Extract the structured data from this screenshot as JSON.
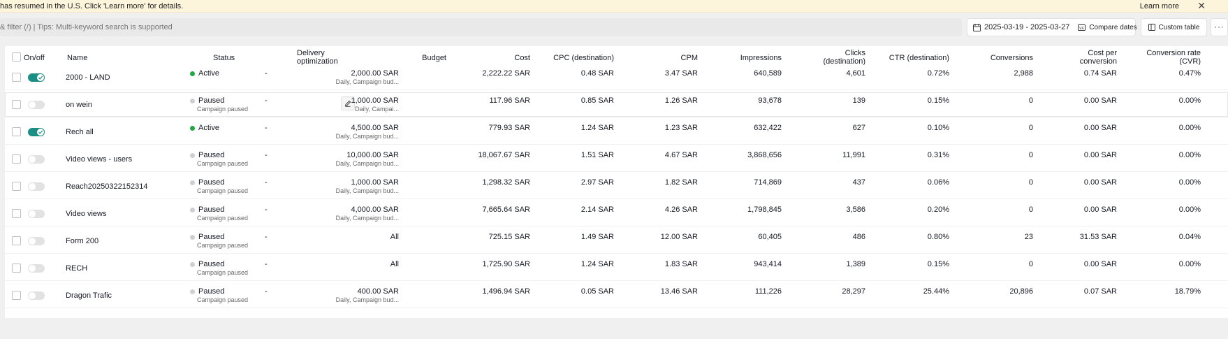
{
  "banner": {
    "text": "has resumed in the U.S. Click 'Learn more' for details.",
    "learn_more": "Learn more",
    "close": "✕"
  },
  "toolbar": {
    "search_placeholder": "& filter (/) | Tips: Multi-keyword search is supported",
    "date_range": "2025-03-19 - 2025-03-27",
    "compare_dates": "Compare dates",
    "custom_table": "Custom table",
    "more": "···"
  },
  "table": {
    "headers": {
      "onoff": "On/off",
      "name": "Name",
      "status": "Status",
      "delivery_1": "Delivery",
      "delivery_2": "optimization",
      "budget": "Budget",
      "cost": "Cost",
      "cpc": "CPC (destination)",
      "cpm": "CPM",
      "impressions": "Impressions",
      "clicks_1": "Clicks",
      "clicks_2": "(destination)",
      "ctr": "CTR (destination)",
      "conversions": "Conversions",
      "cpconv_1": "Cost per",
      "cpconv_2": "conversion",
      "cvr_1": "Conversion rate",
      "cvr_2": "(CVR)"
    },
    "rows": [
      {
        "on": true,
        "name": "2000 - LAND",
        "status": "Active",
        "status_sub": "",
        "delivery": "-",
        "budget": "2,000.00 SAR",
        "budget_sub": "Daily, Campaign bud...",
        "cost": "2,222.22 SAR",
        "cpc": "0.48 SAR",
        "cpm": "3.47 SAR",
        "impressions": "640,589",
        "clicks": "4,601",
        "ctr": "0.72%",
        "conversions": "2,988",
        "cost_per_conv": "0.74 SAR",
        "cvr": "0.47%"
      },
      {
        "on": false,
        "name": "on wein",
        "status": "Paused",
        "status_sub": "Campaign paused",
        "delivery": "-",
        "budget": "1,000.00 SAR",
        "budget_sub": "Daily, Campai...",
        "cost": "117.96 SAR",
        "cpc": "0.85 SAR",
        "cpm": "1.26 SAR",
        "impressions": "93,678",
        "clicks": "139",
        "ctr": "0.15%",
        "conversions": "0",
        "cost_per_conv": "0.00 SAR",
        "cvr": "0.00%"
      },
      {
        "on": true,
        "name": "Rech all",
        "status": "Active",
        "status_sub": "",
        "delivery": "-",
        "budget": "4,500.00 SAR",
        "budget_sub": "Daily, Campaign bud...",
        "cost": "779.93 SAR",
        "cpc": "1.24 SAR",
        "cpm": "1.23 SAR",
        "impressions": "632,422",
        "clicks": "627",
        "ctr": "0.10%",
        "conversions": "0",
        "cost_per_conv": "0.00 SAR",
        "cvr": "0.00%"
      },
      {
        "on": false,
        "name": "Video views - users",
        "status": "Paused",
        "status_sub": "Campaign paused",
        "delivery": "-",
        "budget": "10,000.00 SAR",
        "budget_sub": "Daily, Campaign bud...",
        "cost": "18,067.67 SAR",
        "cpc": "1.51 SAR",
        "cpm": "4.67 SAR",
        "impressions": "3,868,656",
        "clicks": "11,991",
        "ctr": "0.31%",
        "conversions": "0",
        "cost_per_conv": "0.00 SAR",
        "cvr": "0.00%"
      },
      {
        "on": false,
        "name": "Reach20250322152314",
        "status": "Paused",
        "status_sub": "Campaign paused",
        "delivery": "-",
        "budget": "1,000.00 SAR",
        "budget_sub": "Daily, Campaign bud...",
        "cost": "1,298.32 SAR",
        "cpc": "2.97 SAR",
        "cpm": "1.82 SAR",
        "impressions": "714,869",
        "clicks": "437",
        "ctr": "0.06%",
        "conversions": "0",
        "cost_per_conv": "0.00 SAR",
        "cvr": "0.00%"
      },
      {
        "on": false,
        "name": "Video views",
        "status": "Paused",
        "status_sub": "Campaign paused",
        "delivery": "-",
        "budget": "4,000.00 SAR",
        "budget_sub": "Daily, Campaign bud...",
        "cost": "7,665.64 SAR",
        "cpc": "2.14 SAR",
        "cpm": "4.26 SAR",
        "impressions": "1,798,845",
        "clicks": "3,586",
        "ctr": "0.20%",
        "conversions": "0",
        "cost_per_conv": "0.00 SAR",
        "cvr": "0.00%"
      },
      {
        "on": false,
        "name": "Form 200",
        "status": "Paused",
        "status_sub": "Campaign paused",
        "delivery": "-",
        "budget": "All",
        "budget_sub": "",
        "cost": "725.15 SAR",
        "cpc": "1.49 SAR",
        "cpm": "12.00 SAR",
        "impressions": "60,405",
        "clicks": "486",
        "ctr": "0.80%",
        "conversions": "23",
        "cost_per_conv": "31.53 SAR",
        "cvr": "0.04%"
      },
      {
        "on": false,
        "name": "RECH",
        "status": "Paused",
        "status_sub": "Campaign paused",
        "delivery": "-",
        "budget": "All",
        "budget_sub": "",
        "cost": "1,725.90 SAR",
        "cpc": "1.24 SAR",
        "cpm": "1.83 SAR",
        "impressions": "943,414",
        "clicks": "1,389",
        "ctr": "0.15%",
        "conversions": "0",
        "cost_per_conv": "0.00 SAR",
        "cvr": "0.00%"
      },
      {
        "on": false,
        "name": "Dragon Trafic",
        "status": "Paused",
        "status_sub": "Campaign paused",
        "delivery": "-",
        "budget": "400.00 SAR",
        "budget_sub": "Daily, Campaign bud...",
        "cost": "1,496.94 SAR",
        "cpc": "0.05 SAR",
        "cpm": "13.46 SAR",
        "impressions": "111,226",
        "clicks": "28,297",
        "ctr": "25.44%",
        "conversions": "20,896",
        "cost_per_conv": "0.07 SAR",
        "cvr": "18.79%"
      }
    ]
  },
  "colors": {
    "banner_bg": "#fcf5dc",
    "toggle_on": "#1b8e85",
    "active_dot": "#22a745",
    "paused_dot": "#cfcfcf"
  }
}
